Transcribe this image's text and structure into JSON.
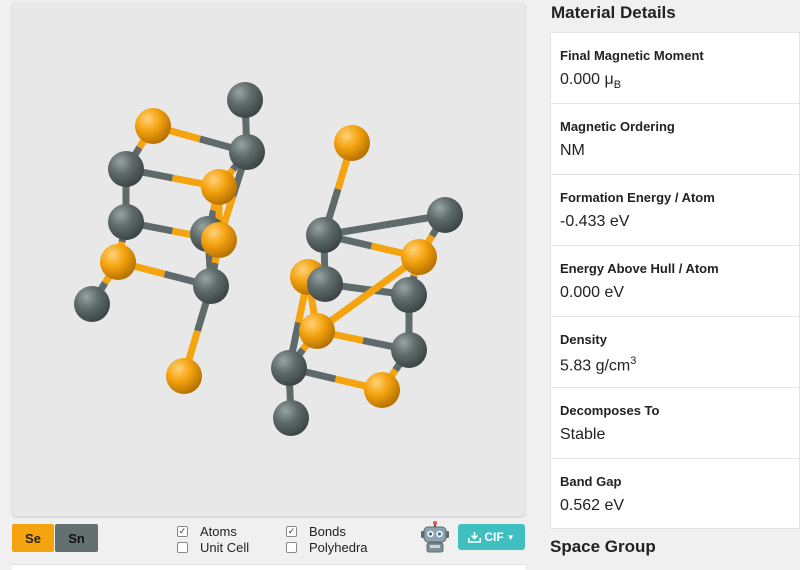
{
  "viewer": {
    "colors": {
      "Se": "#f5a30f",
      "Sn": "#5f6b6b",
      "bond_se": "#f5a30f",
      "bond_sn": "#5f6b6b"
    }
  },
  "legend": {
    "se": {
      "label": "Se",
      "color": "#f5a30f"
    },
    "sn": {
      "label": "Sn",
      "color": "#63706f"
    }
  },
  "options": {
    "atoms": {
      "label": "Atoms",
      "checked": true
    },
    "unit_cell": {
      "label": "Unit Cell",
      "checked": false
    },
    "bonds": {
      "label": "Bonds",
      "checked": true
    },
    "polyhedra": {
      "label": "Polyhedra",
      "checked": false
    }
  },
  "cif_button": {
    "label": "CIF",
    "color": "#3fbfbf"
  },
  "details": {
    "title": "Material Details",
    "magnetic_moment": {
      "label": "Final Magnetic Moment",
      "value": "0.000 μ",
      "unit_sub": "B"
    },
    "magnetic_ordering": {
      "label": "Magnetic Ordering",
      "value": "NM"
    },
    "formation_energy": {
      "label": "Formation Energy / Atom",
      "value": "-0.433 eV"
    },
    "energy_above_hull": {
      "label": "Energy Above Hull / Atom",
      "value": "0.000 eV"
    },
    "density": {
      "label": "Density",
      "value": "5.83 g/cm",
      "unit_sup": "3"
    },
    "decomposes_to": {
      "label": "Decomposes To",
      "value": "Stable"
    },
    "band_gap": {
      "label": "Band Gap",
      "value": "0.562 eV"
    }
  },
  "space_group": {
    "title": "Space Group"
  }
}
